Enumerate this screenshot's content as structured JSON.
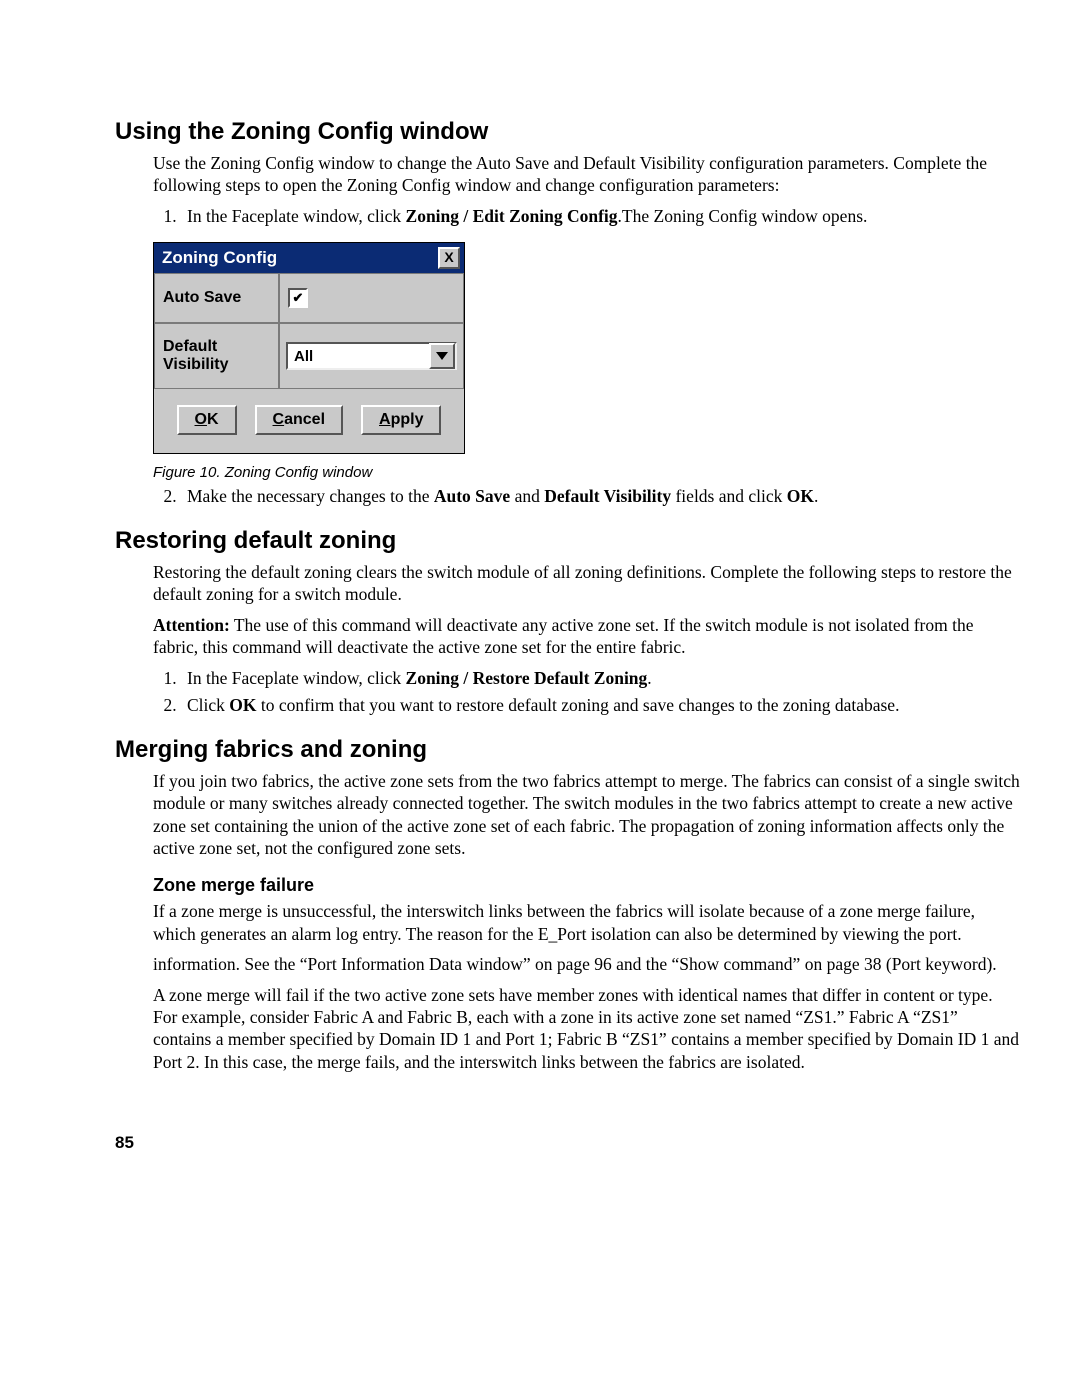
{
  "section1": {
    "heading": "Using the Zoning Config window",
    "p1": "Use the Zoning Config window to change the Auto Save and Default Visibility configuration parameters. Complete the following steps to open the Zoning Config window and change configuration parameters:",
    "step1_a": "In the Faceplate window, click ",
    "step1_b": "Zoning / Edit Zoning Config",
    "step1_c": ".The Zoning Config window opens.",
    "step2_a": "Make the necessary changes to the ",
    "step2_b": "Auto Save",
    "step2_c": " and ",
    "step2_d": "Default Visibility",
    "step2_e": " fields and click ",
    "step2_f": "OK",
    "step2_g": "."
  },
  "dialog": {
    "title": "Zoning Config",
    "close": "X",
    "row1_label": "Auto Save",
    "row1_check": "✔",
    "row2_label": "Default Visibility",
    "row2_value": "All",
    "ok_mn": "O",
    "ok_rest": "K",
    "cancel_mn": "C",
    "cancel_rest": "ancel",
    "apply_mn": "A",
    "apply_rest": "pply"
  },
  "figure_caption": "Figure 10. Zoning Config window",
  "section2": {
    "heading": "Restoring default zoning",
    "p1": "Restoring the default zoning clears the switch module of all zoning definitions. Complete the following steps to restore the default zoning for a switch module.",
    "attn_label": "Attention:",
    "attn_body": "   The use of this command will deactivate any active zone set. If the switch module is not isolated from the fabric, this command will deactivate the active zone set for the entire fabric.",
    "step1_a": "In the Faceplate window, click ",
    "step1_b": "Zoning / Restore Default Zoning",
    "step1_c": ".",
    "step2_a": "Click ",
    "step2_b": "OK",
    "step2_c": " to confirm that you want to restore default zoning and save changes to the zoning database."
  },
  "section3": {
    "heading": "Merging fabrics and zoning",
    "p1": "If you join two fabrics, the active zone sets from the two fabrics attempt to merge. The fabrics can consist of a single switch module or many switches already connected together. The switch modules in the two fabrics attempt to create a new active zone set containing the union of the active zone set of each fabric. The propagation of zoning information affects only the active zone set, not the configured zone sets.",
    "sub_heading": "Zone merge failure",
    "p2": "If a zone merge is unsuccessful, the interswitch links between the fabrics will isolate because of a zone merge failure, which generates an alarm log entry. The reason for the E_Port isolation can also be determined by viewing the port.",
    "p3": "information. See the “Port Information Data window” on page 96 and the “Show command” on page 38 (Port keyword).",
    "p4": "A zone merge will fail if the two active zone sets have member zones with identical names that differ in content or type. For example, consider Fabric A and Fabric B, each with a zone in its active zone set named “ZS1.” Fabric A “ZS1” contains a member specified by Domain ID 1 and Port 1; Fabric B “ZS1” contains a member specified by Domain ID 1 and Port 2. In this case, the merge fails, and the interswitch links between the fabrics are isolated."
  },
  "page_number": "85"
}
